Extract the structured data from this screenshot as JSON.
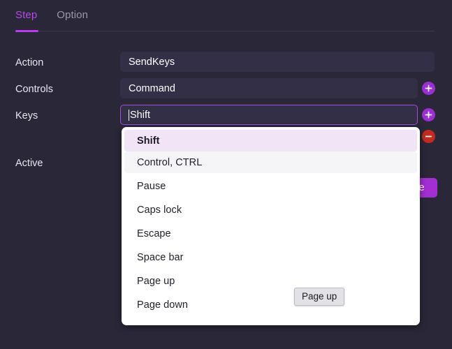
{
  "tabs": [
    {
      "label": "Step",
      "active": true
    },
    {
      "label": "Option",
      "active": false
    }
  ],
  "fields": {
    "action": {
      "label": "Action",
      "value": "SendKeys"
    },
    "controls": {
      "label": "Controls",
      "value": "Command"
    },
    "keys": {
      "label": "Keys",
      "value": "Shift"
    },
    "active": {
      "label": "Active"
    }
  },
  "buttons": {
    "add_controls": "+",
    "add_keys": "+",
    "remove_keys": "−",
    "save": "Save"
  },
  "dropdown": {
    "items": [
      {
        "label": "Shift",
        "state": "selected"
      },
      {
        "label": "Control, CTRL",
        "state": "hover"
      },
      {
        "label": "Pause",
        "state": "normal"
      },
      {
        "label": "Caps lock",
        "state": "normal"
      },
      {
        "label": "Escape",
        "state": "normal"
      },
      {
        "label": "Space bar",
        "state": "normal"
      },
      {
        "label": "Page up",
        "state": "normal"
      },
      {
        "label": "Page down",
        "state": "normal"
      }
    ]
  },
  "tooltip": {
    "text": "Page up"
  },
  "colors": {
    "background": "#2a2739",
    "field_background": "#332f46",
    "accent_purple": "#b63ef0",
    "add_button": "#9b2fd4",
    "remove_button": "#c42b1f",
    "save_button": "#a32fd4",
    "dropdown_background": "#ffffff",
    "selected_item": "#f2e4f7",
    "tooltip_background": "#e2e2e6"
  }
}
